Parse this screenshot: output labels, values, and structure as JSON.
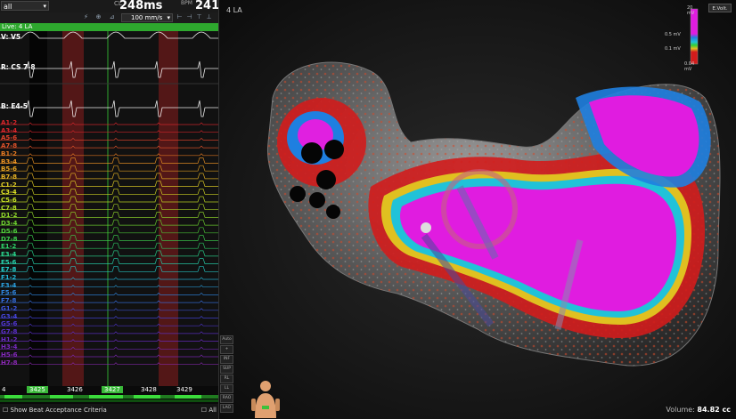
{
  "toolbar": {
    "view_select": "all",
    "cl_label": "CL",
    "cl_value": "248ms",
    "bpm_label": "BPM",
    "bpm_value": "241",
    "speed": "100 mm/s",
    "icons": [
      "filter-icon",
      "lock-icon",
      "ruler-icon"
    ]
  },
  "live": "Live: 4 LA",
  "channels": [
    {
      "label": "V: V5",
      "color": "#ffffff",
      "big": true
    },
    {
      "label": "R: CS 7-8",
      "color": "#ffffff",
      "big": true
    },
    {
      "label": "B: E4-5",
      "color": "#ffffff",
      "big": true
    },
    {
      "label": "A1-2",
      "color": "#d9262b"
    },
    {
      "label": "A3-4",
      "color": "#d9262b"
    },
    {
      "label": "A5-6",
      "color": "#e2432b"
    },
    {
      "label": "A7-8",
      "color": "#e0522a"
    },
    {
      "label": "B1-2",
      "color": "#e87b22"
    },
    {
      "label": "B3-4",
      "color": "#ec9323"
    },
    {
      "label": "B5-6",
      "color": "#e8a322"
    },
    {
      "label": "B7-8",
      "color": "#e6b224"
    },
    {
      "label": "C1-2",
      "color": "#e4d226"
    },
    {
      "label": "C3-4",
      "color": "#dfe326"
    },
    {
      "label": "C5-6",
      "color": "#c6e025"
    },
    {
      "label": "C7-8",
      "color": "#b2de27"
    },
    {
      "label": "D1-2",
      "color": "#8ed42a"
    },
    {
      "label": "D3-4",
      "color": "#6dd22f"
    },
    {
      "label": "D5-6",
      "color": "#4fd03a"
    },
    {
      "label": "D7-8",
      "color": "#3ccf4c"
    },
    {
      "label": "E1-2",
      "color": "#2fd168"
    },
    {
      "label": "E3-4",
      "color": "#29d38c"
    },
    {
      "label": "E5-6",
      "color": "#27d3ad"
    },
    {
      "label": "E7-8",
      "color": "#25cfcc"
    },
    {
      "label": "F1-2",
      "color": "#24b6d6"
    },
    {
      "label": "F3-4",
      "color": "#2a9dda"
    },
    {
      "label": "F5-6",
      "color": "#2f84dc"
    },
    {
      "label": "F7-8",
      "color": "#356ddd"
    },
    {
      "label": "G1-2",
      "color": "#3c56db"
    },
    {
      "label": "G3-4",
      "color": "#4444d8"
    },
    {
      "label": "G5-6",
      "color": "#5036d2"
    },
    {
      "label": "G7-8",
      "color": "#5c2fcb"
    },
    {
      "label": "H1-2",
      "color": "#6a2bc4"
    },
    {
      "label": "H3-4",
      "color": "#7629bd"
    },
    {
      "label": "H5-6",
      "color": "#8028b8"
    },
    {
      "label": "H7-8",
      "color": "#8928b2"
    }
  ],
  "beats": {
    "left_index": "4",
    "items": [
      "3425",
      "3426",
      "3427",
      "3428",
      "3429"
    ],
    "selected_index": 0
  },
  "bottom": {
    "show_beat": "Show Beat Acceptance Criteria",
    "all": "All"
  },
  "map": {
    "title": "4 LA",
    "volume_label": "Volume:",
    "volume_value": "84.82 cc",
    "evolt": "E.Volt.",
    "colorbar": [
      "20 mV",
      "0.5 mV",
      "0.1 mV",
      "0.04 mV"
    ],
    "side_buttons": [
      "Auto",
      "+",
      "INF",
      "SUP",
      "RL",
      "LL",
      "RAO",
      "LAO"
    ]
  }
}
